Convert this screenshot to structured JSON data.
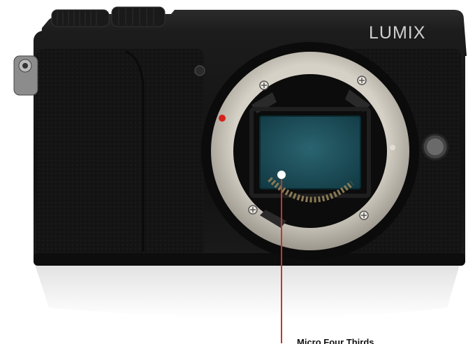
{
  "brand": {
    "logo_text": "LUMIX"
  },
  "callout": {
    "label": "Micro Four Thirds"
  },
  "colors": {
    "body": "#121212",
    "mount_ring": "#bdb8ad",
    "sensor": "#1e4e5a",
    "callout_line": "#c0392b",
    "red_dot": "#d3211b"
  }
}
